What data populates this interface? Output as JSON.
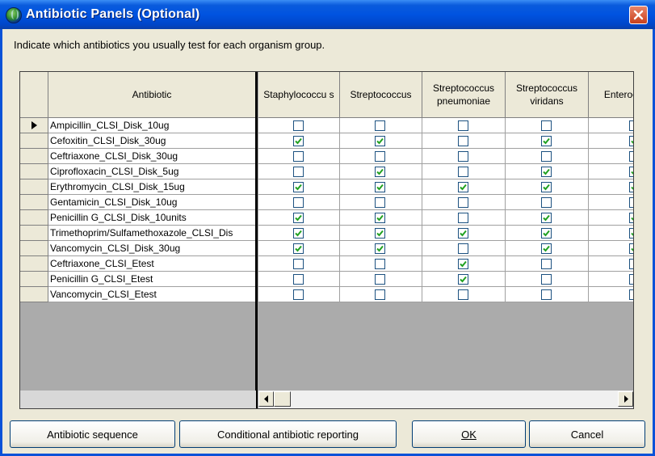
{
  "window": {
    "title": "Antibiotic Panels (Optional)"
  },
  "instruction": "Indicate which antibiotics you usually test for each organism group.",
  "grid": {
    "antibiotic_header": "Antibiotic",
    "columns": [
      {
        "label": "Staphylococcu s"
      },
      {
        "label": "Streptococcus"
      },
      {
        "label": "Streptococcus pneumoniae"
      },
      {
        "label": "Streptococcus viridans"
      },
      {
        "label": "Enteroc"
      }
    ],
    "current_row": 0,
    "rows": [
      {
        "name": "Ampicillin_CLSI_Disk_10ug",
        "checks": [
          false,
          false,
          false,
          false,
          false
        ]
      },
      {
        "name": "Cefoxitin_CLSI_Disk_30ug",
        "checks": [
          true,
          true,
          false,
          true,
          true
        ]
      },
      {
        "name": "Ceftriaxone_CLSI_Disk_30ug",
        "checks": [
          false,
          false,
          false,
          false,
          false
        ]
      },
      {
        "name": "Ciprofloxacin_CLSI_Disk_5ug",
        "checks": [
          false,
          true,
          false,
          true,
          true
        ]
      },
      {
        "name": "Erythromycin_CLSI_Disk_15ug",
        "checks": [
          true,
          true,
          true,
          true,
          true
        ]
      },
      {
        "name": "Gentamicin_CLSI_Disk_10ug",
        "checks": [
          false,
          false,
          false,
          false,
          false
        ]
      },
      {
        "name": "Penicillin G_CLSI_Disk_10units",
        "checks": [
          true,
          true,
          false,
          true,
          true
        ]
      },
      {
        "name": "Trimethoprim/Sulfamethoxazole_CLSI_Dis",
        "checks": [
          true,
          true,
          true,
          true,
          true
        ]
      },
      {
        "name": "Vancomycin_CLSI_Disk_30ug",
        "checks": [
          true,
          true,
          false,
          true,
          true
        ]
      },
      {
        "name": "Ceftriaxone_CLSI_Etest",
        "checks": [
          false,
          false,
          true,
          false,
          false
        ]
      },
      {
        "name": "Penicillin G_CLSI_Etest",
        "checks": [
          false,
          false,
          true,
          false,
          false
        ]
      },
      {
        "name": "Vancomycin_CLSI_Etest",
        "checks": [
          false,
          false,
          false,
          false,
          false
        ]
      }
    ]
  },
  "buttons": {
    "antibiotic_sequence": "Antibiotic sequence",
    "conditional_reporting": "Conditional antibiotic reporting",
    "ok": "OK",
    "cancel": "Cancel"
  },
  "colors": {
    "titlebar": "#0053e0",
    "close_button": "#c8401c",
    "face": "#ece9d8",
    "grid_empty": "#ababab"
  },
  "icons": [
    "app-globe-icon",
    "close-icon",
    "current-row-arrow-icon",
    "scroll-left-icon",
    "scroll-right-icon"
  ]
}
